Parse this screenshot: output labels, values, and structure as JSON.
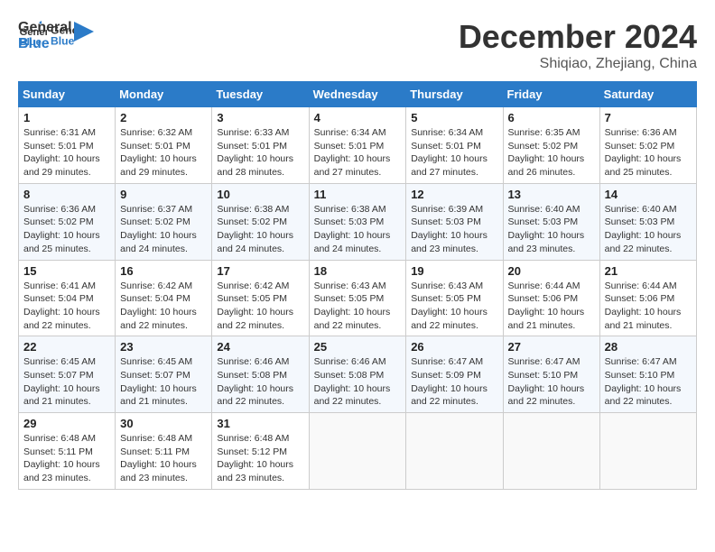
{
  "header": {
    "logo_line1": "General",
    "logo_line2": "Blue",
    "month": "December 2024",
    "location": "Shiqiao, Zhejiang, China"
  },
  "weekdays": [
    "Sunday",
    "Monday",
    "Tuesday",
    "Wednesday",
    "Thursday",
    "Friday",
    "Saturday"
  ],
  "weeks": [
    [
      {
        "day": "1",
        "sunrise": "6:31 AM",
        "sunset": "5:01 PM",
        "daylight": "10 hours and 29 minutes."
      },
      {
        "day": "2",
        "sunrise": "6:32 AM",
        "sunset": "5:01 PM",
        "daylight": "10 hours and 29 minutes."
      },
      {
        "day": "3",
        "sunrise": "6:33 AM",
        "sunset": "5:01 PM",
        "daylight": "10 hours and 28 minutes."
      },
      {
        "day": "4",
        "sunrise": "6:34 AM",
        "sunset": "5:01 PM",
        "daylight": "10 hours and 27 minutes."
      },
      {
        "day": "5",
        "sunrise": "6:34 AM",
        "sunset": "5:01 PM",
        "daylight": "10 hours and 27 minutes."
      },
      {
        "day": "6",
        "sunrise": "6:35 AM",
        "sunset": "5:02 PM",
        "daylight": "10 hours and 26 minutes."
      },
      {
        "day": "7",
        "sunrise": "6:36 AM",
        "sunset": "5:02 PM",
        "daylight": "10 hours and 25 minutes."
      }
    ],
    [
      {
        "day": "8",
        "sunrise": "6:36 AM",
        "sunset": "5:02 PM",
        "daylight": "10 hours and 25 minutes."
      },
      {
        "day": "9",
        "sunrise": "6:37 AM",
        "sunset": "5:02 PM",
        "daylight": "10 hours and 24 minutes."
      },
      {
        "day": "10",
        "sunrise": "6:38 AM",
        "sunset": "5:02 PM",
        "daylight": "10 hours and 24 minutes."
      },
      {
        "day": "11",
        "sunrise": "6:38 AM",
        "sunset": "5:03 PM",
        "daylight": "10 hours and 24 minutes."
      },
      {
        "day": "12",
        "sunrise": "6:39 AM",
        "sunset": "5:03 PM",
        "daylight": "10 hours and 23 minutes."
      },
      {
        "day": "13",
        "sunrise": "6:40 AM",
        "sunset": "5:03 PM",
        "daylight": "10 hours and 23 minutes."
      },
      {
        "day": "14",
        "sunrise": "6:40 AM",
        "sunset": "5:03 PM",
        "daylight": "10 hours and 22 minutes."
      }
    ],
    [
      {
        "day": "15",
        "sunrise": "6:41 AM",
        "sunset": "5:04 PM",
        "daylight": "10 hours and 22 minutes."
      },
      {
        "day": "16",
        "sunrise": "6:42 AM",
        "sunset": "5:04 PM",
        "daylight": "10 hours and 22 minutes."
      },
      {
        "day": "17",
        "sunrise": "6:42 AM",
        "sunset": "5:05 PM",
        "daylight": "10 hours and 22 minutes."
      },
      {
        "day": "18",
        "sunrise": "6:43 AM",
        "sunset": "5:05 PM",
        "daylight": "10 hours and 22 minutes."
      },
      {
        "day": "19",
        "sunrise": "6:43 AM",
        "sunset": "5:05 PM",
        "daylight": "10 hours and 22 minutes."
      },
      {
        "day": "20",
        "sunrise": "6:44 AM",
        "sunset": "5:06 PM",
        "daylight": "10 hours and 21 minutes."
      },
      {
        "day": "21",
        "sunrise": "6:44 AM",
        "sunset": "5:06 PM",
        "daylight": "10 hours and 21 minutes."
      }
    ],
    [
      {
        "day": "22",
        "sunrise": "6:45 AM",
        "sunset": "5:07 PM",
        "daylight": "10 hours and 21 minutes."
      },
      {
        "day": "23",
        "sunrise": "6:45 AM",
        "sunset": "5:07 PM",
        "daylight": "10 hours and 21 minutes."
      },
      {
        "day": "24",
        "sunrise": "6:46 AM",
        "sunset": "5:08 PM",
        "daylight": "10 hours and 22 minutes."
      },
      {
        "day": "25",
        "sunrise": "6:46 AM",
        "sunset": "5:08 PM",
        "daylight": "10 hours and 22 minutes."
      },
      {
        "day": "26",
        "sunrise": "6:47 AM",
        "sunset": "5:09 PM",
        "daylight": "10 hours and 22 minutes."
      },
      {
        "day": "27",
        "sunrise": "6:47 AM",
        "sunset": "5:10 PM",
        "daylight": "10 hours and 22 minutes."
      },
      {
        "day": "28",
        "sunrise": "6:47 AM",
        "sunset": "5:10 PM",
        "daylight": "10 hours and 22 minutes."
      }
    ],
    [
      {
        "day": "29",
        "sunrise": "6:48 AM",
        "sunset": "5:11 PM",
        "daylight": "10 hours and 23 minutes."
      },
      {
        "day": "30",
        "sunrise": "6:48 AM",
        "sunset": "5:11 PM",
        "daylight": "10 hours and 23 minutes."
      },
      {
        "day": "31",
        "sunrise": "6:48 AM",
        "sunset": "5:12 PM",
        "daylight": "10 hours and 23 minutes."
      },
      null,
      null,
      null,
      null
    ]
  ]
}
